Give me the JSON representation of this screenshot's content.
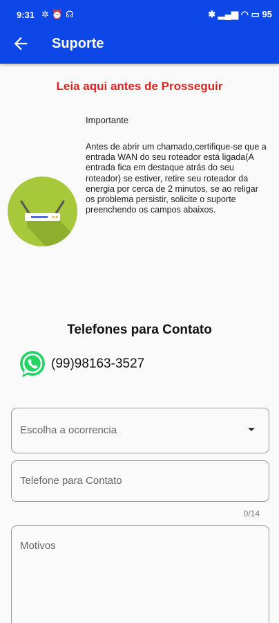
{
  "status_bar": {
    "time": "9:31",
    "left_icons": [
      "fan-icon",
      "alarm-icon",
      "headset-icon"
    ],
    "battery": "95"
  },
  "app_bar": {
    "title": "Suporte"
  },
  "notice": {
    "title": "Leia aqui antes de Prosseguir",
    "heading": "Importante",
    "body": "Antes de abrir um chamado,certifique-se que a entrada WAN do seu roteador está ligada(A entrada fica em destaque atrás do seu roteador) se estiver, retire seu roteador da energia por cerca de 2 minutos, se ao religar os problema persistir, solicite o suporte preenchendo os campos abaixos."
  },
  "contacts": {
    "title": "Telefones para Contato",
    "whatsapp_number": "(99)98163-3527"
  },
  "form": {
    "occurrence_label": "Escolha a ocorrencia",
    "phone_label": "Telefone para Contato",
    "phone_counter": "0/14",
    "reasons_label": "Motivos"
  },
  "colors": {
    "primary": "#0d47e8",
    "notice_red": "#e02424",
    "router_green": "#a8c83c",
    "whatsapp_green": "#25d366"
  }
}
